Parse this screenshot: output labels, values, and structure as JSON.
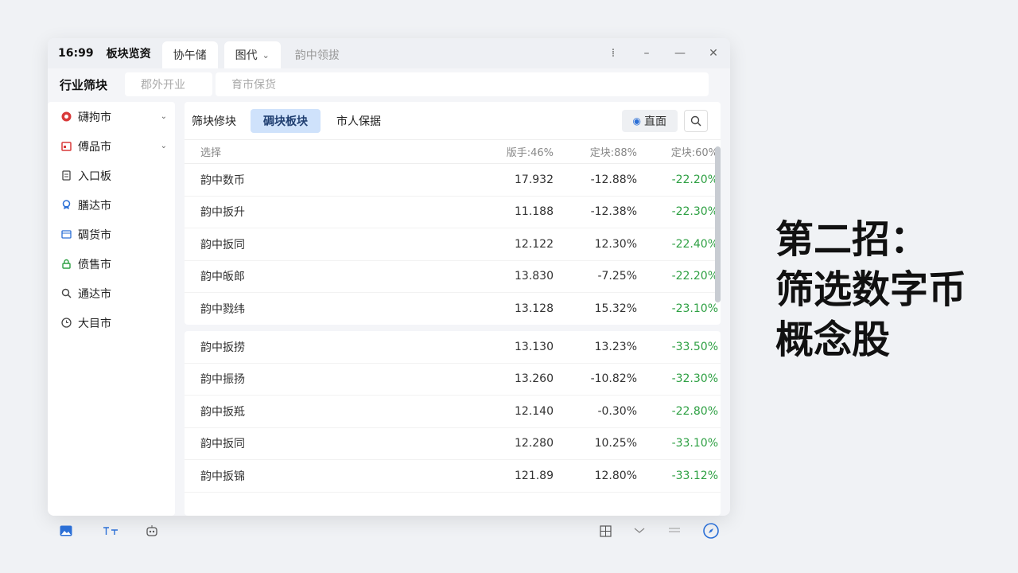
{
  "titlebar": {
    "time": "16:99",
    "app_title": "板块览资",
    "tabs": [
      {
        "label": "协午储"
      },
      {
        "label": "图代"
      },
      {
        "label": "韵中领拔"
      }
    ],
    "controls": [
      "⁞",
      "–",
      "—",
      "✕"
    ]
  },
  "filter_bar": {
    "label": "行业筛块",
    "field_a": "郡外开业",
    "field_b": "育市保货"
  },
  "sidebar": {
    "items": [
      {
        "label": "礴拘市",
        "icon": "red-circle-icon"
      },
      {
        "label": "傅品市",
        "icon": "calendar-icon"
      },
      {
        "label": "入口板",
        "icon": "document-icon"
      },
      {
        "label": "膳达市",
        "icon": "badge-icon"
      },
      {
        "label": "碉货市",
        "icon": "box-icon"
      },
      {
        "label": "偾售市",
        "icon": "lock-icon"
      },
      {
        "label": "通达市",
        "icon": "search-icon"
      },
      {
        "label": "大目市",
        "icon": "clock-icon"
      }
    ]
  },
  "toolbar": {
    "label": "筛块修块",
    "tab_active": "碉块板块",
    "tab_other": "市人保据",
    "query_button": "直面"
  },
  "table": {
    "headers": [
      "选择",
      "版手:46%",
      "定块:88%",
      "定块:60%"
    ],
    "top_rows": [
      [
        "韵中数币",
        "17.932",
        "-12.88%",
        "-22.20%"
      ],
      [
        "韵中扳升",
        "11.188",
        "-12.38%",
        "-22.30%"
      ],
      [
        "韵中扳同",
        "12.122",
        "12.30%",
        "-22.40%"
      ],
      [
        "韵中皈郎",
        "13.830",
        "-7.25%",
        "-22.20%"
      ],
      [
        "韵中戮纬",
        "13.128",
        "15.32%",
        "-23.10%"
      ]
    ],
    "bottom_rows": [
      [
        "韵中扳捞",
        "13.130",
        "13.23%",
        "-33.50%"
      ],
      [
        "韵中振扬",
        "13.260",
        "-10.82%",
        "-32.30%"
      ],
      [
        "韵中扳羝",
        "12.140",
        "-0.30%",
        "-22.80%"
      ],
      [
        "韵中扳同",
        "12.280",
        "10.25%",
        "-33.10%"
      ],
      [
        "韵中扳锦",
        "121.89",
        "12.80%",
        "-33.12%"
      ]
    ]
  },
  "headline": {
    "line1": "第二招：",
    "line2": "筛选数字币",
    "line3": "概念股"
  },
  "colors": {
    "accent": "#cfe2fb",
    "positive_green": "#2ea043",
    "brand_blue": "#2b6fd6"
  }
}
